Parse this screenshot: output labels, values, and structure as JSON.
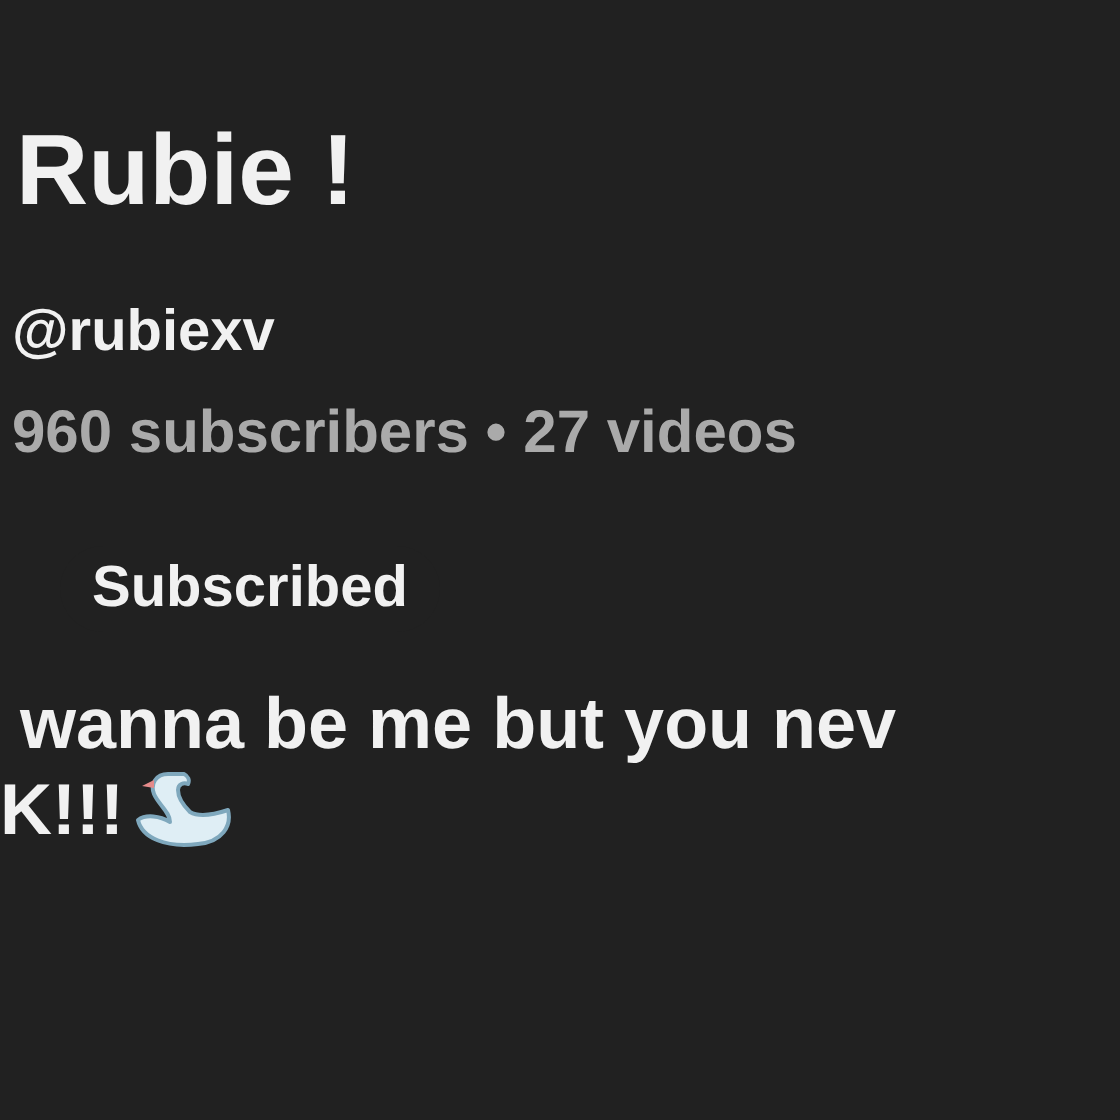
{
  "channel": {
    "name": "Rubie !",
    "handle": "@rubiexv",
    "stats": "960 subscribers • 27 videos"
  },
  "subscribe_button": {
    "label": "Subscribed"
  },
  "bio": {
    "lines": [
      "wanna be me but you nev",
      "K!!!"
    ]
  }
}
